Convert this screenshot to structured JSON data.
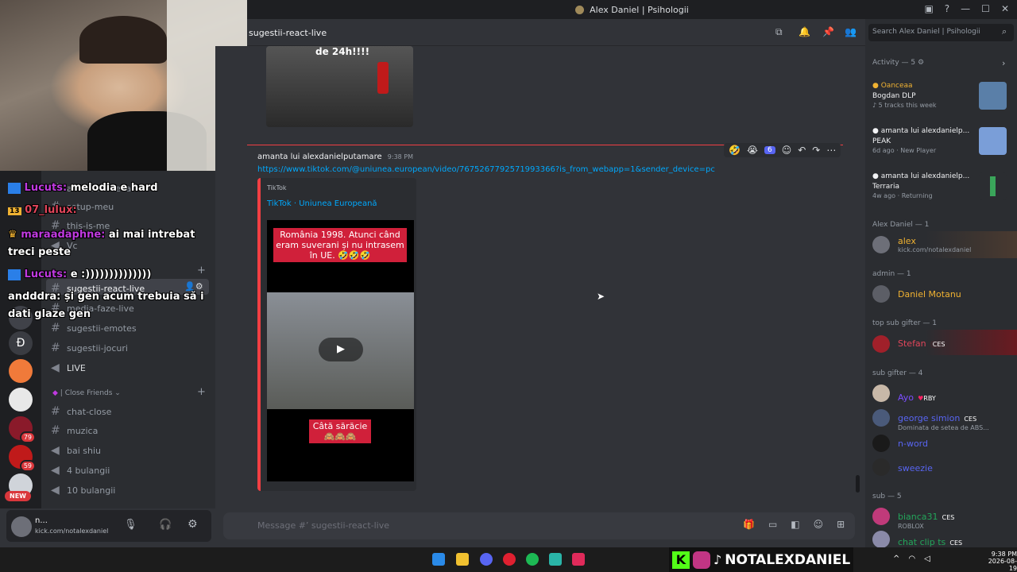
{
  "window": {
    "title": "Alex Daniel | Psihologii",
    "controls": [
      "—",
      "☐",
      "✕"
    ]
  },
  "overlay_chat": [
    {
      "user": "Lucuts:",
      "user_color": "#c03ae0",
      "text": "melodia e hard"
    },
    {
      "user": "07_lulux:",
      "user_color": "#e0455a",
      "text": ""
    },
    {
      "user": "maraadaphne:",
      "user_color": "#c03ae0",
      "text": "ai mai intrebat"
    },
    {
      "user": "",
      "user_color": "#fff",
      "text": "treci peste"
    },
    {
      "user": "Lucuts:",
      "user_color": "#c03ae0",
      "text": "e :))))))))))))))"
    },
    {
      "user": "andddra:",
      "user_color": "#ffffff",
      "text": "și gen acum trebuia să i"
    },
    {
      "user": "",
      "user_color": "#fff",
      "text": "dati glaze gen"
    }
  ],
  "overlay_badge_13": "13",
  "channels": {
    "items": [
      {
        "name": "anime-lol-ceva",
        "icon": "hash"
      },
      {
        "name": "setup-meu",
        "icon": "hash"
      },
      {
        "name": "this-is-me",
        "icon": "hash"
      },
      {
        "name": "Vc",
        "icon": "speaker"
      },
      {
        "name": "sugestii-react-live",
        "icon": "hash",
        "active": true
      },
      {
        "name": "media-faze-live",
        "icon": "hash"
      },
      {
        "name": "sugestii-emotes",
        "icon": "hash"
      },
      {
        "name": "sugestii-jocuri",
        "icon": "hash"
      },
      {
        "name": "LIVE",
        "icon": "speaker"
      }
    ],
    "category_close_friends": "| Close Friends",
    "close_items": [
      {
        "name": "chat-close",
        "icon": "hash"
      },
      {
        "name": "muzica",
        "icon": "hash"
      },
      {
        "name": "bai shiu",
        "icon": "speaker"
      },
      {
        "name": "4 bulangii",
        "icon": "speaker"
      },
      {
        "name": "10 bulangii",
        "icon": "speaker"
      }
    ]
  },
  "server_badges": [
    "79",
    "59",
    "NEW"
  ],
  "user_panel": {
    "name": "n...",
    "status": "kick.com/notalexdaniel"
  },
  "header": {
    "channel": "sugestii-react-live",
    "search_placeholder": "Search Alex Daniel | Psihologii"
  },
  "messages": {
    "top_image_caption": "de 24h!!!!",
    "author": "amanta lui alexdanielputamare",
    "time": "9:38 PM",
    "link": "https://www.tiktok.com/@uniunea.european/video/7675267792571993366?is_from_webapp=1&sender_device=pc",
    "embed_provider": "TikTok",
    "embed_title": "TikTok · Uniunea Europeană",
    "video_top_text": "România 1998. Atunci când eram suverani și nu intrasem în UE. 🤣🤣🤣",
    "video_bottom_text": "Câtă sărăcie 🙈🙈🙈",
    "reaction_count": "6"
  },
  "composer": {
    "placeholder": "Message #ʼ sugestii-react-live"
  },
  "members": {
    "activity_header": "Activity — 5",
    "activities": [
      {
        "user": "Oanceaa",
        "title": "Bogdan DLP",
        "sub": "5 tracks this week"
      },
      {
        "user": "amanta lui alexdanielp...",
        "title": "PEAK",
        "sub": "6d ago",
        "tag": "New Player"
      },
      {
        "user": "amanta lui alexdanielp...",
        "title": "Terraria",
        "sub": "4w ago",
        "tag": "Returning"
      }
    ],
    "groups": [
      {
        "header": "Alex Daniel — 1",
        "members": [
          {
            "name": "alex",
            "color": "#f0b232",
            "sub": "kick.com/notalexdaniel"
          }
        ]
      },
      {
        "header": "admin — 1",
        "members": [
          {
            "name": "Daniel Motanu",
            "color": "#f0b232",
            "sub": ""
          }
        ]
      },
      {
        "header": "top sub gifter — 1",
        "members": [
          {
            "name": "Stefan",
            "color": "#e0455a",
            "tag": "CES",
            "sub": ""
          }
        ]
      },
      {
        "header": "sub gifter — 4",
        "members": [
          {
            "name": "Ayo",
            "color": "#7c4dff",
            "tag": "RBY",
            "sub": ""
          },
          {
            "name": "george simion",
            "color": "#5865f2",
            "tag": "CES",
            "sub": "Dominata de setea de ABS..."
          },
          {
            "name": "n-word",
            "color": "#5865f2",
            "sub": ""
          },
          {
            "name": "sweezie",
            "color": "#5865f2",
            "sub": ""
          }
        ]
      },
      {
        "header": "sub — 5",
        "members": [
          {
            "name": "bianca31",
            "color": "#23a55a",
            "tag": "CES",
            "sub": "ROBLOX"
          },
          {
            "name": "chat clip ts",
            "color": "#23a55a",
            "tag": "CES",
            "sub": ""
          }
        ]
      }
    ]
  },
  "taskbar": {
    "time": "9:38 PM",
    "date": "2026-08-19",
    "watermark": "NOTALEXDANIEL"
  },
  "colors": {
    "bg": "#313338",
    "sidebar": "#2b2d31",
    "rail": "#1e1f22",
    "link": "#00a8fc",
    "accent": "#5865f2"
  }
}
